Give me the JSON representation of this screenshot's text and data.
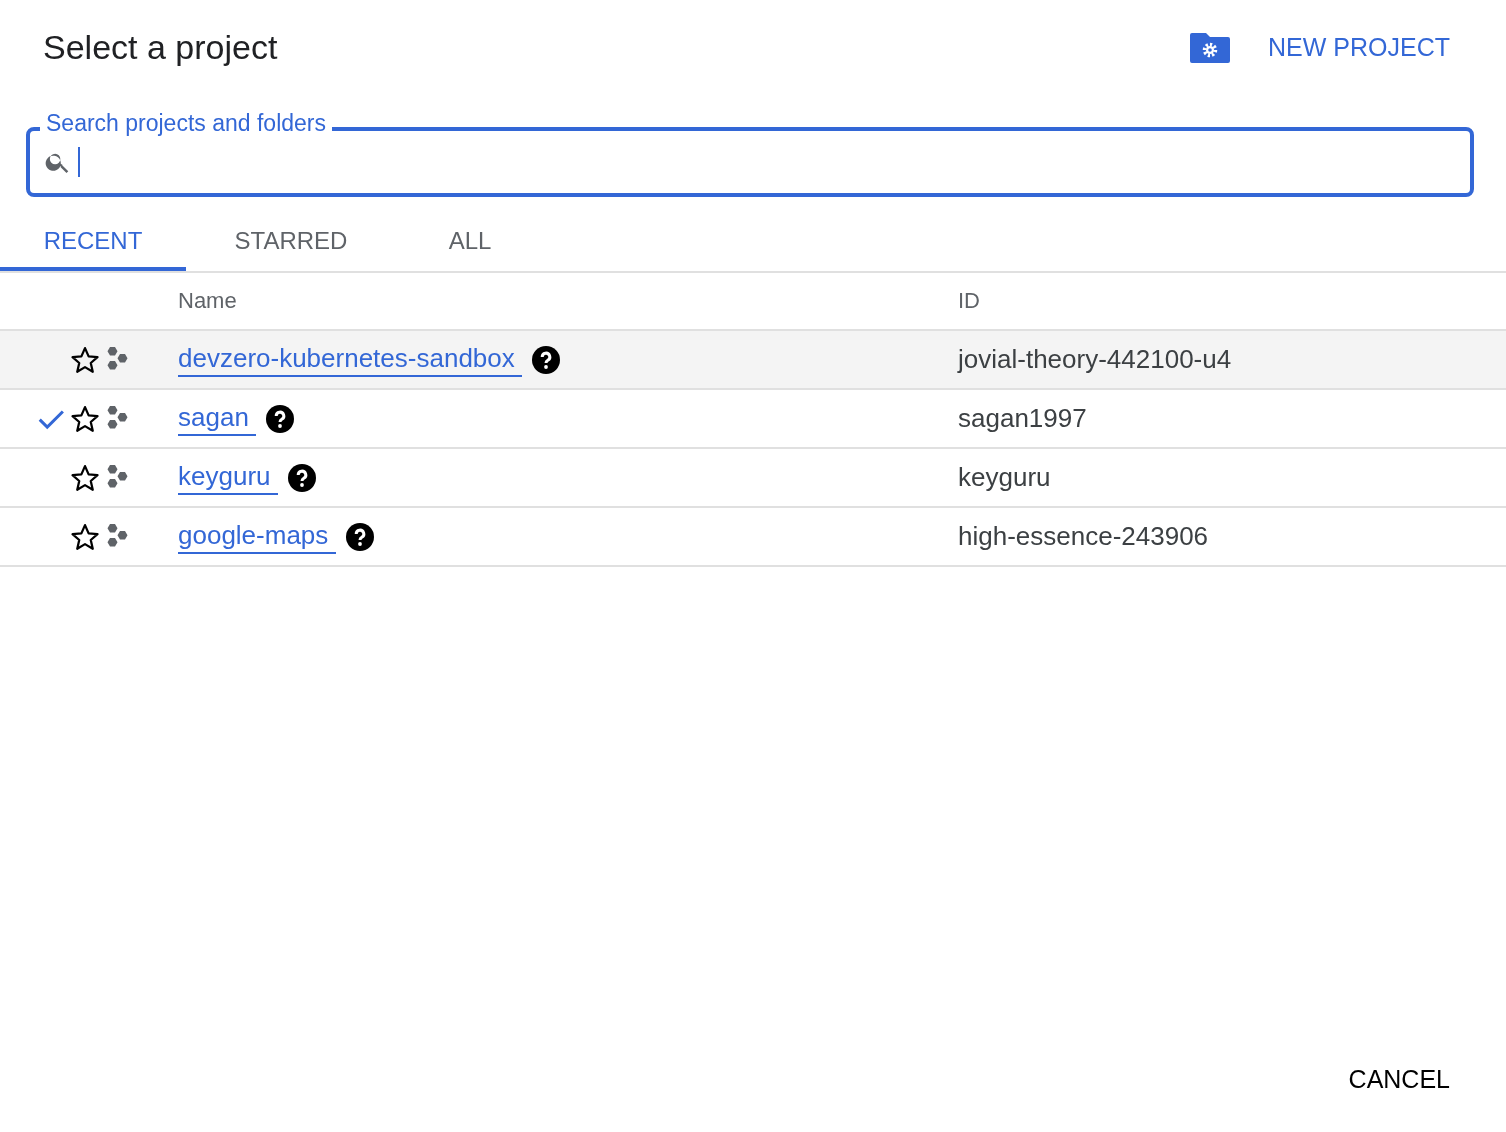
{
  "dialog": {
    "title": "Select a project",
    "new_project": "NEW PROJECT"
  },
  "search": {
    "label": "Search projects and folders"
  },
  "tabs": [
    {
      "label": "RECENT",
      "selected": true
    },
    {
      "label": "STARRED",
      "selected": false
    },
    {
      "label": "ALL",
      "selected": false
    }
  ],
  "table": {
    "columns": [
      "Name",
      "ID"
    ],
    "rows": [
      {
        "name": "devzero-kubernetes-sandbox",
        "id": "jovial-theory-442100-u4",
        "selected": false,
        "highlighted": true,
        "starred": false
      },
      {
        "name": "sagan",
        "id": "sagan1997",
        "selected": true,
        "highlighted": false,
        "starred": false
      },
      {
        "name": "keyguru",
        "id": "keyguru",
        "selected": false,
        "highlighted": false,
        "starred": false
      },
      {
        "name": "google-maps",
        "id": "high-essence-243906",
        "selected": false,
        "highlighted": false,
        "starred": false
      }
    ]
  },
  "buttons": [
    "CANCEL"
  ]
}
